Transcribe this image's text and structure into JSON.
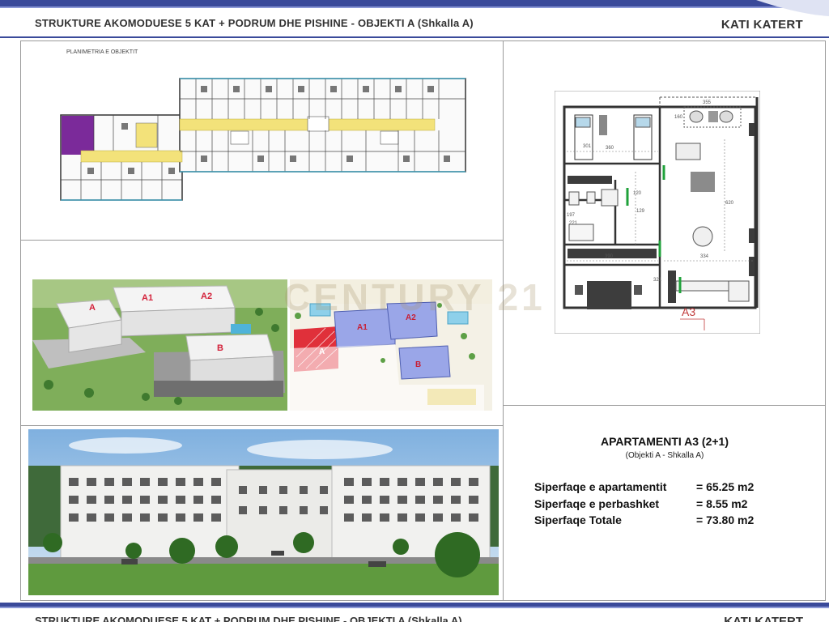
{
  "header": {
    "title": "STRUKTURE AKOMODUESE 5 KAT + PODRUM DHE PISHINE   -  OBJEKTI A (Shkalla A)",
    "floor": "KATI KATERT"
  },
  "footer": {
    "title": "STRUKTURE AKOMODUESE 5 KAT + PODRUM DHE PISHINE   -  OBJEKTI A (Shkalla A)",
    "floor": "KATI KATERT"
  },
  "floorplan": {
    "label": "PLANIMETRIA E OBJEKTIT"
  },
  "aerial": {
    "labels": [
      "A",
      "A1",
      "A2",
      "B"
    ]
  },
  "siteplan": {
    "labels": [
      "A",
      "A1",
      "A2",
      "B"
    ]
  },
  "unit_plan": {
    "unit_label": "A3",
    "dims": [
      "355",
      "160",
      "360",
      "301",
      "120",
      "221",
      "390",
      "334",
      "620",
      "321",
      "129",
      "197"
    ]
  },
  "apartment": {
    "title": "APARTAMENTI A3 (2+1)",
    "subtitle": "(Objekti A - Shkalla A)",
    "rows": [
      {
        "label": "Siperfaqe e apartamentit",
        "value": "=  65.25 m2"
      },
      {
        "label": "Siperfaqe e perbashket",
        "value": "=   8.55 m2"
      },
      {
        "label": "Siperfaqe Totale",
        "value": "= 73.80 m2"
      }
    ]
  },
  "watermark": "CENTURY 21",
  "colors": {
    "brand_blue": "#3a4a9a",
    "light_blue": "#8b98d6",
    "highlight_purple": "#7b2a9a",
    "corridor_yellow": "#f3e27a",
    "site_red": "#e0303a",
    "site_blue": "#9aa6e8"
  }
}
